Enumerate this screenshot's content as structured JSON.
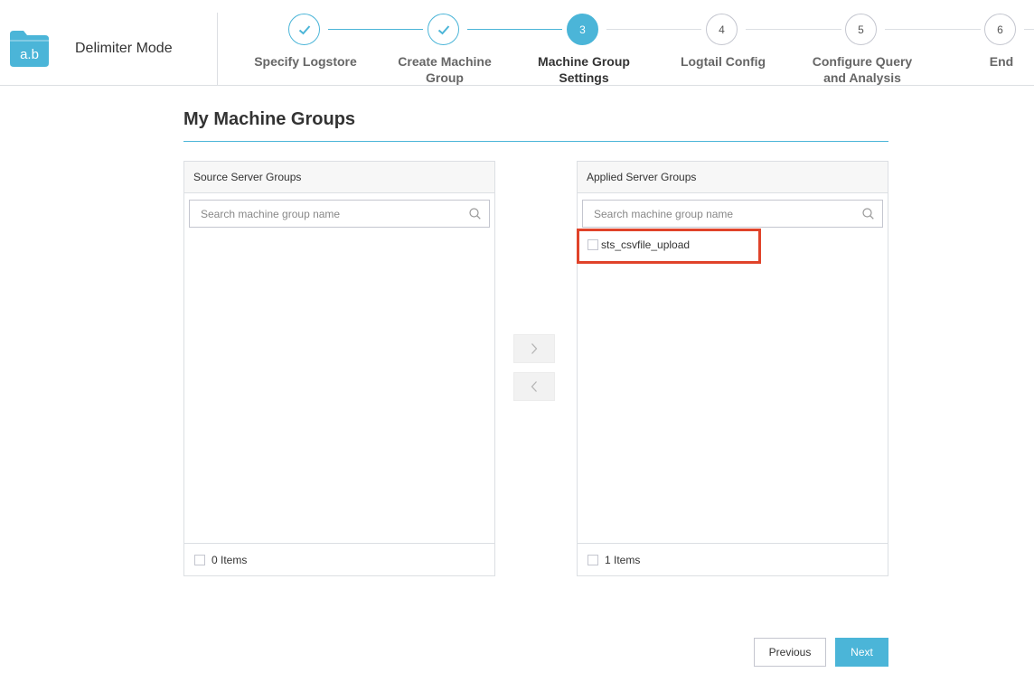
{
  "header": {
    "logo_text": "a.b",
    "mode_title": "Delimiter Mode"
  },
  "steps": [
    {
      "number": "1",
      "label_line1": "Specify Logstore",
      "label_line2": "",
      "status": "done"
    },
    {
      "number": "2",
      "label_line1": "Create Machine",
      "label_line2": "Group",
      "status": "done"
    },
    {
      "number": "3",
      "label_line1": "Machine Group",
      "label_line2": "Settings",
      "status": "active"
    },
    {
      "number": "4",
      "label_line1": "Logtail Config",
      "label_line2": "",
      "status": "pending"
    },
    {
      "number": "5",
      "label_line1": "Configure Query",
      "label_line2": "and Analysis",
      "status": "pending"
    },
    {
      "number": "6",
      "label_line1": "End",
      "label_line2": "",
      "status": "pending"
    }
  ],
  "section": {
    "title": "My Machine Groups"
  },
  "source_panel": {
    "title": "Source Server Groups",
    "search_placeholder": "Search machine group name",
    "items": [],
    "count_label": "0 Items"
  },
  "applied_panel": {
    "title": "Applied Server Groups",
    "search_placeholder": "Search machine group name",
    "items": [
      {
        "label": "sts_csvfile_upload",
        "highlighted": true
      }
    ],
    "count_label": "1 Items"
  },
  "transfer": {
    "move_right_icon": "chevron-right-icon",
    "move_left_icon": "chevron-left-icon"
  },
  "footer": {
    "previous_label": "Previous",
    "next_label": "Next"
  },
  "colors": {
    "accent": "#4bb5d8",
    "highlight": "#e0432a",
    "border": "#dcdfe3"
  }
}
